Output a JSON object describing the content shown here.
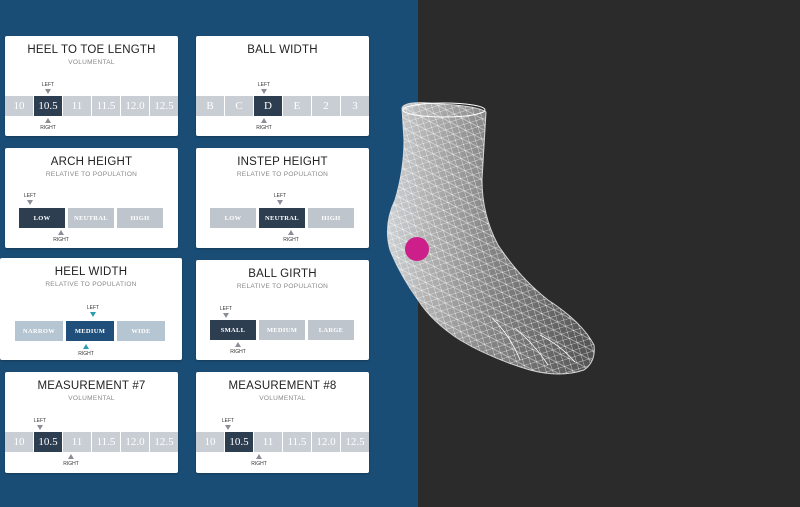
{
  "markers": {
    "left": "LEFT",
    "right": "RIGHT"
  },
  "cards": {
    "heel_to_toe": {
      "title": "HEEL TO TOE LENGTH",
      "subtitle": "VOLUMENTAL",
      "options": [
        "10",
        "10.5",
        "11",
        "11.5",
        "12.0",
        "12.5"
      ],
      "selected": "10.5"
    },
    "ball_width": {
      "title": "BALL WIDTH",
      "subtitle": "",
      "options": [
        "B",
        "C",
        "D",
        "E",
        "2",
        "3"
      ],
      "selected": "D"
    },
    "arch_height": {
      "title": "ARCH HEIGHT",
      "subtitle": "RELATIVE TO POPULATION",
      "options": [
        "LOW",
        "NEUTRAL",
        "HIGH"
      ],
      "selected": "LOW"
    },
    "instep_height": {
      "title": "INSTEP HEIGHT",
      "subtitle": "RELATIVE TO POPULATION",
      "options": [
        "LOW",
        "NEUTRAL",
        "HIGH"
      ],
      "selected": "NEUTRAL"
    },
    "heel_width": {
      "title": "HEEL WIDTH",
      "subtitle": "RELATIVE TO POPULATION",
      "options": [
        "NARROW",
        "MEDIUM",
        "WIDE"
      ],
      "selected": "MEDIUM"
    },
    "ball_girth": {
      "title": "BALL GIRTH",
      "subtitle": "RELATIVE TO POPULATION",
      "options": [
        "SMALL",
        "MEDIUM",
        "LARGE"
      ],
      "selected": "SMALL"
    },
    "measurement_7": {
      "title": "MEASUREMENT #7",
      "subtitle": "VOLUMENTAL",
      "options": [
        "10",
        "10.5",
        "11",
        "11.5",
        "12.0",
        "12.5"
      ],
      "selected": "10.5"
    },
    "measurement_8": {
      "title": "MEASUREMENT #8",
      "subtitle": "VOLUMENTAL",
      "options": [
        "10",
        "10.5",
        "11",
        "11.5",
        "12.0",
        "12.5"
      ],
      "selected": "10.5"
    }
  },
  "colors": {
    "panel_blue": "#1a4d75",
    "viewer_dark": "#2b2b2b",
    "selected": "#2c3e50",
    "unselected": "#c9ced4",
    "hotspot": "#cc1f8a",
    "accent_teal": "#2a9db0"
  },
  "icons": {
    "hotspot": "pink-hotspot-marker",
    "foot_model": "wireframe-foot-3d-model"
  }
}
